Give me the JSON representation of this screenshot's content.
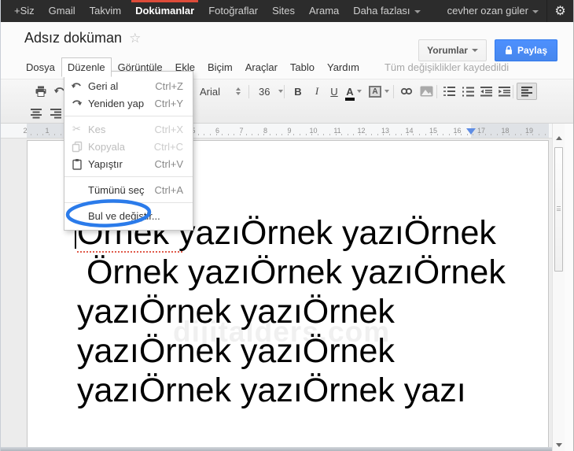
{
  "topbar": {
    "items": [
      "+Siz",
      "Gmail",
      "Takvim",
      "Dokümanlar",
      "Fotoğraflar",
      "Sites",
      "Arama"
    ],
    "more_label": "Daha fazlası",
    "active_item": "Dokümanlar",
    "user_name": "cevher ozan güler",
    "accent_color": "#dd4b39"
  },
  "header": {
    "doc_title": "Adsız doküman",
    "comments_label": "Yorumlar",
    "share_label": "Paylaş",
    "share_color": "#4d90fe",
    "save_status": "Tüm değişiklikler kaydedildi",
    "menus": [
      "Dosya",
      "Düzenle",
      "Görüntüle",
      "Ekle",
      "Biçim",
      "Araçlar",
      "Tablo",
      "Yardım"
    ],
    "open_menu": "Düzenle"
  },
  "toolbar": {
    "font_name": "Arial",
    "font_size": "36",
    "bold_label": "B",
    "italic_label": "I",
    "underline_label": "U",
    "text_color_label": "A",
    "highlight_label": "A"
  },
  "edit_menu": {
    "items": [
      {
        "label": "Geri al",
        "shortcut": "Ctrl+Z",
        "icon": "undo-icon",
        "disabled": false
      },
      {
        "label": "Yeniden yap",
        "shortcut": "Ctrl+Y",
        "icon": "redo-icon",
        "disabled": false
      },
      {
        "label": "Kes",
        "shortcut": "Ctrl+X",
        "icon": "scissors-icon",
        "disabled": true
      },
      {
        "label": "Kopyala",
        "shortcut": "Ctrl+C",
        "icon": "copy-icon",
        "disabled": true
      },
      {
        "label": "Yapıştır",
        "shortcut": "Ctrl+V",
        "icon": "paste-icon",
        "disabled": false
      },
      {
        "label": "Tümünü seç",
        "shortcut": "Ctrl+A",
        "icon": "",
        "disabled": false
      },
      {
        "label": "Bul ve değiştir...",
        "shortcut": "",
        "icon": "",
        "disabled": false,
        "circled": true
      }
    ],
    "annotation_color": "#2b7bea"
  },
  "ruler": {
    "left_numbers": [
      "2",
      "1"
    ],
    "numbers": [
      "5",
      "6",
      "7",
      "8",
      "9",
      "10",
      "11",
      "12",
      "13",
      "14",
      "15",
      "16",
      "17",
      "18",
      "19"
    ]
  },
  "document": {
    "lines": [
      "Örnek yazıÖrnek yazıÖrnek",
      " Örnek yazıÖrnek yazıÖrnek",
      "yazıÖrnek yazıÖrnek",
      "yazıÖrnek yazıÖrnek",
      "yazıÖrnek yazıÖrnek yazı"
    ],
    "watermark": "dijitalders.com"
  }
}
